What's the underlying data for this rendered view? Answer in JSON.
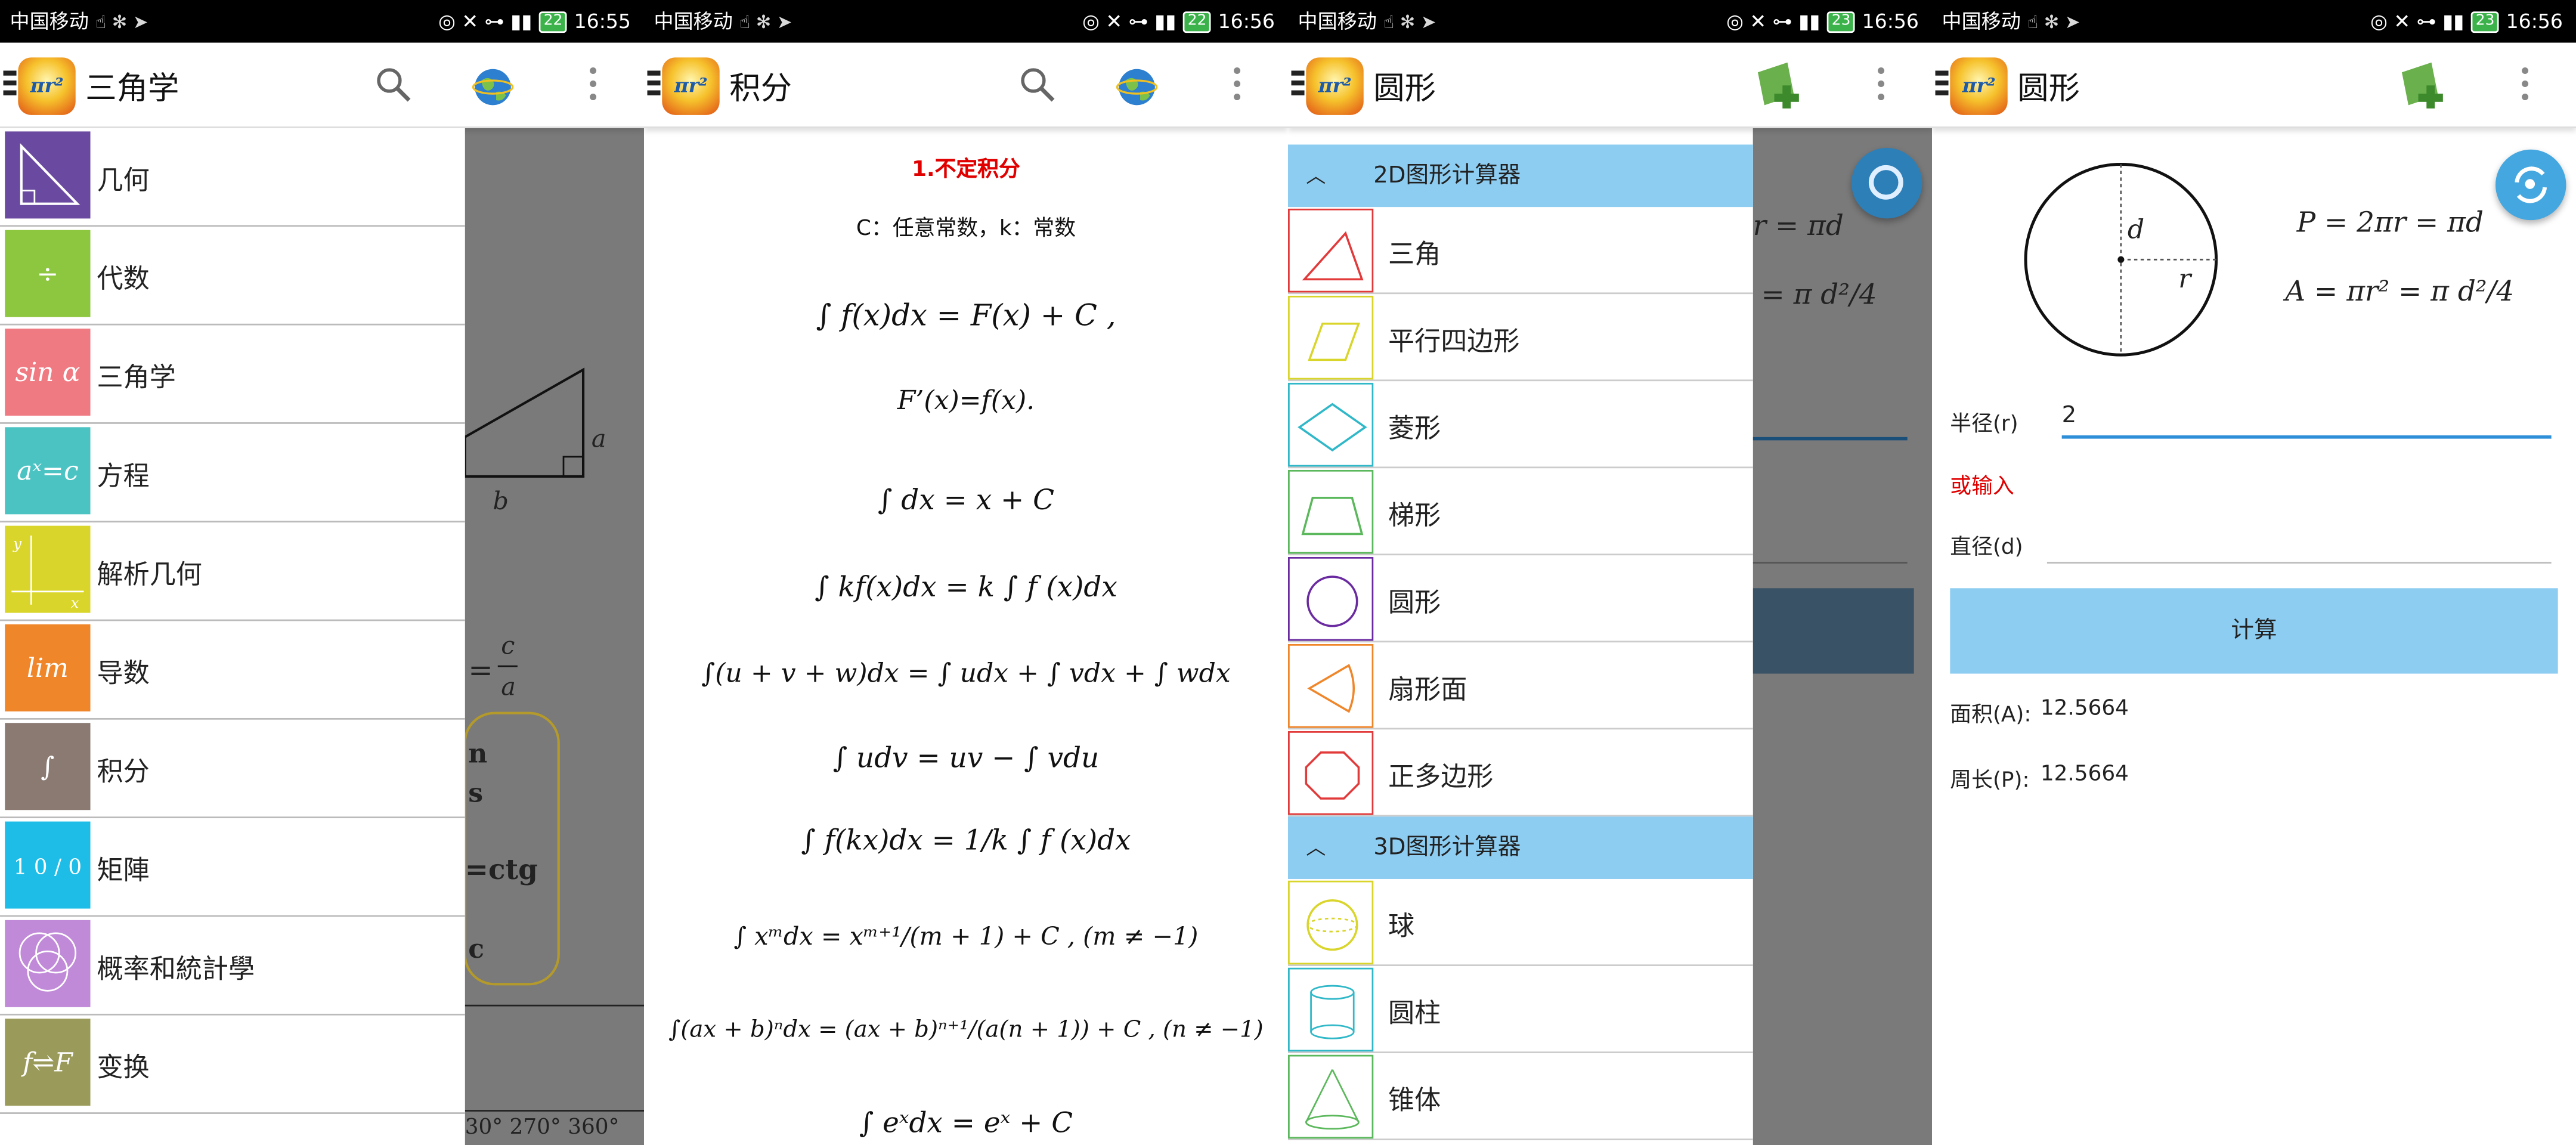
{
  "statusbar": [
    {
      "carrier": "中国移动",
      "battery": "22",
      "time": "16:55"
    },
    {
      "carrier": "中国移动",
      "battery": "22",
      "time": "16:56"
    },
    {
      "carrier": "中国移动",
      "battery": "23",
      "time": "16:56"
    },
    {
      "carrier": "中国移动",
      "battery": "23",
      "time": "16:56"
    }
  ],
  "app_logo": "πr²",
  "screen1": {
    "title": "三角学",
    "menu": [
      {
        "label": "几何",
        "tile": "",
        "color": "#6a4aa0"
      },
      {
        "label": "代数",
        "tile": "÷",
        "color": "#8dc63f"
      },
      {
        "label": "三角学",
        "tile": "sin α",
        "color": "#f07a82"
      },
      {
        "label": "方程",
        "tile": "aˣ=c",
        "color": "#4cc3c3"
      },
      {
        "label": "解析几何",
        "tile": "",
        "color": "#d9d52a"
      },
      {
        "label": "导数",
        "tile": "lim",
        "color": "#f0862a"
      },
      {
        "label": "积分",
        "tile": "∫",
        "color": "#8a7a72"
      },
      {
        "label": "矩陣",
        "tile": "1 0 / 0 1",
        "color": "#1dbde8"
      },
      {
        "label": "概率和統計學",
        "tile": "",
        "color": "#c08ad8"
      },
      {
        "label": "变换",
        "tile": "f⇌F",
        "color": "#9a9a5a"
      }
    ],
    "bg": {
      "a": "a",
      "b": "b",
      "frac_c": "c",
      "frac_a": "a",
      "box": [
        "n",
        "s",
        "=ctg",
        "c"
      ],
      "degs": "30°  270°  360°"
    }
  },
  "screen2": {
    "title": "积分",
    "heading": "1.不定积分",
    "note": "C：任意常数，k：常数",
    "formulas": [
      "∫ f(x)dx = F(x) + C ,",
      "F’(x)=f(x).",
      "∫ dx = x + C",
      "∫ kf(x)dx = k ∫ f (x)dx",
      "∫(u + v + w)dx = ∫ udx + ∫ vdx + ∫ wdx",
      "∫ udv = uv − ∫ vdu",
      "∫ f(kx)dx = 1/k ∫ f (x)dx",
      "∫ xᵐdx = xᵐ⁺¹/(m + 1) + C , (m ≠ −1)",
      "∫(ax + b)ⁿdx = (ax + b)ⁿ⁺¹/(a(n + 1)) + C , (n ≠ −1)",
      "∫ eˣdx = eˣ + C"
    ]
  },
  "screen3": {
    "title": "圆形",
    "group2d": "2D图形计算器",
    "items2d": [
      {
        "label": "三角",
        "color": "#e23a3a"
      },
      {
        "label": "平行四边形",
        "color": "#d9d52a"
      },
      {
        "label": "菱形",
        "color": "#30b8c8"
      },
      {
        "label": "梯形",
        "color": "#5cb85c"
      },
      {
        "label": "圆形",
        "color": "#6a2aa0"
      },
      {
        "label": "扇形面",
        "color": "#f0862a"
      },
      {
        "label": "正多边形",
        "color": "#e23a3a"
      }
    ],
    "group3d": "3D图形计算器",
    "items3d": [
      {
        "label": "球",
        "color": "#d9d52a"
      },
      {
        "label": "圆柱",
        "color": "#30b8c8"
      },
      {
        "label": "锥体",
        "color": "#5cb85c"
      }
    ],
    "bg": {
      "f1": "r = πd",
      "f2": "= π d²/4"
    }
  },
  "screen4": {
    "title": "圆形",
    "fig_d": "d",
    "fig_r": "r",
    "formula_p": "P = 2πr = πd",
    "formula_a": "A = πr² = π d²/4",
    "radius_label": "半径(r)",
    "radius_value": "2",
    "or_label": "或输入",
    "diameter_label": "直径(d)",
    "diameter_value": "",
    "calc_label": "计算",
    "area_label": "面积(A):",
    "area_value": "12.5664",
    "perimeter_label": "周长(P):",
    "perimeter_value": "12.5664"
  },
  "colors": {
    "accent": "#44a7e0",
    "group_bg": "#8ecdf2",
    "red": "#e00000"
  }
}
